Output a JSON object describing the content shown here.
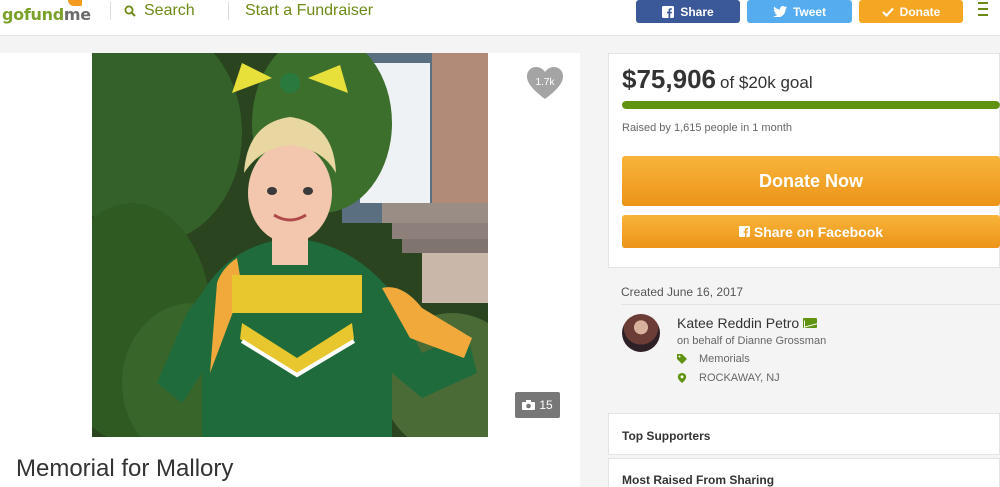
{
  "header": {
    "logo_text_go": "go",
    "logo_text_fund": "fund",
    "logo_text_me": "me",
    "search_label": "Search",
    "start_label": "Start a Fundraiser",
    "share_label": "Share",
    "tweet_label": "Tweet",
    "donate_label": "Donate"
  },
  "campaign": {
    "title": "Memorial for Mallory",
    "hearts": "1.7k",
    "photo_count": "15"
  },
  "donation": {
    "raised": "$75,906",
    "goal_text": "of $20k goal",
    "progress_fraction": 1.0,
    "raised_by": "Raised by 1,615 people in 1 month",
    "donate_now": "Donate Now",
    "share_facebook": "Share on Facebook"
  },
  "organizer": {
    "created": "Created June 16, 2017",
    "name": "Katee Reddin Petro",
    "on_behalf": "on behalf of Dianne Grossman",
    "category": "Memorials",
    "location": "ROCKAWAY, NJ"
  },
  "sections": {
    "top_supporters": "Top Supporters",
    "most_raised": "Most Raised From Sharing"
  },
  "colors": {
    "brand_green": "#6c8a17",
    "facebook_blue": "#3b5998",
    "twitter_blue": "#55acee",
    "donate_orange": "#f5a623",
    "progress_green": "#60930f"
  },
  "icons": [
    "search-icon",
    "facebook-icon",
    "twitter-icon",
    "check-icon",
    "menu-icon",
    "heart-icon",
    "camera-icon",
    "mail-icon",
    "tag-icon",
    "location-pin-icon"
  ]
}
